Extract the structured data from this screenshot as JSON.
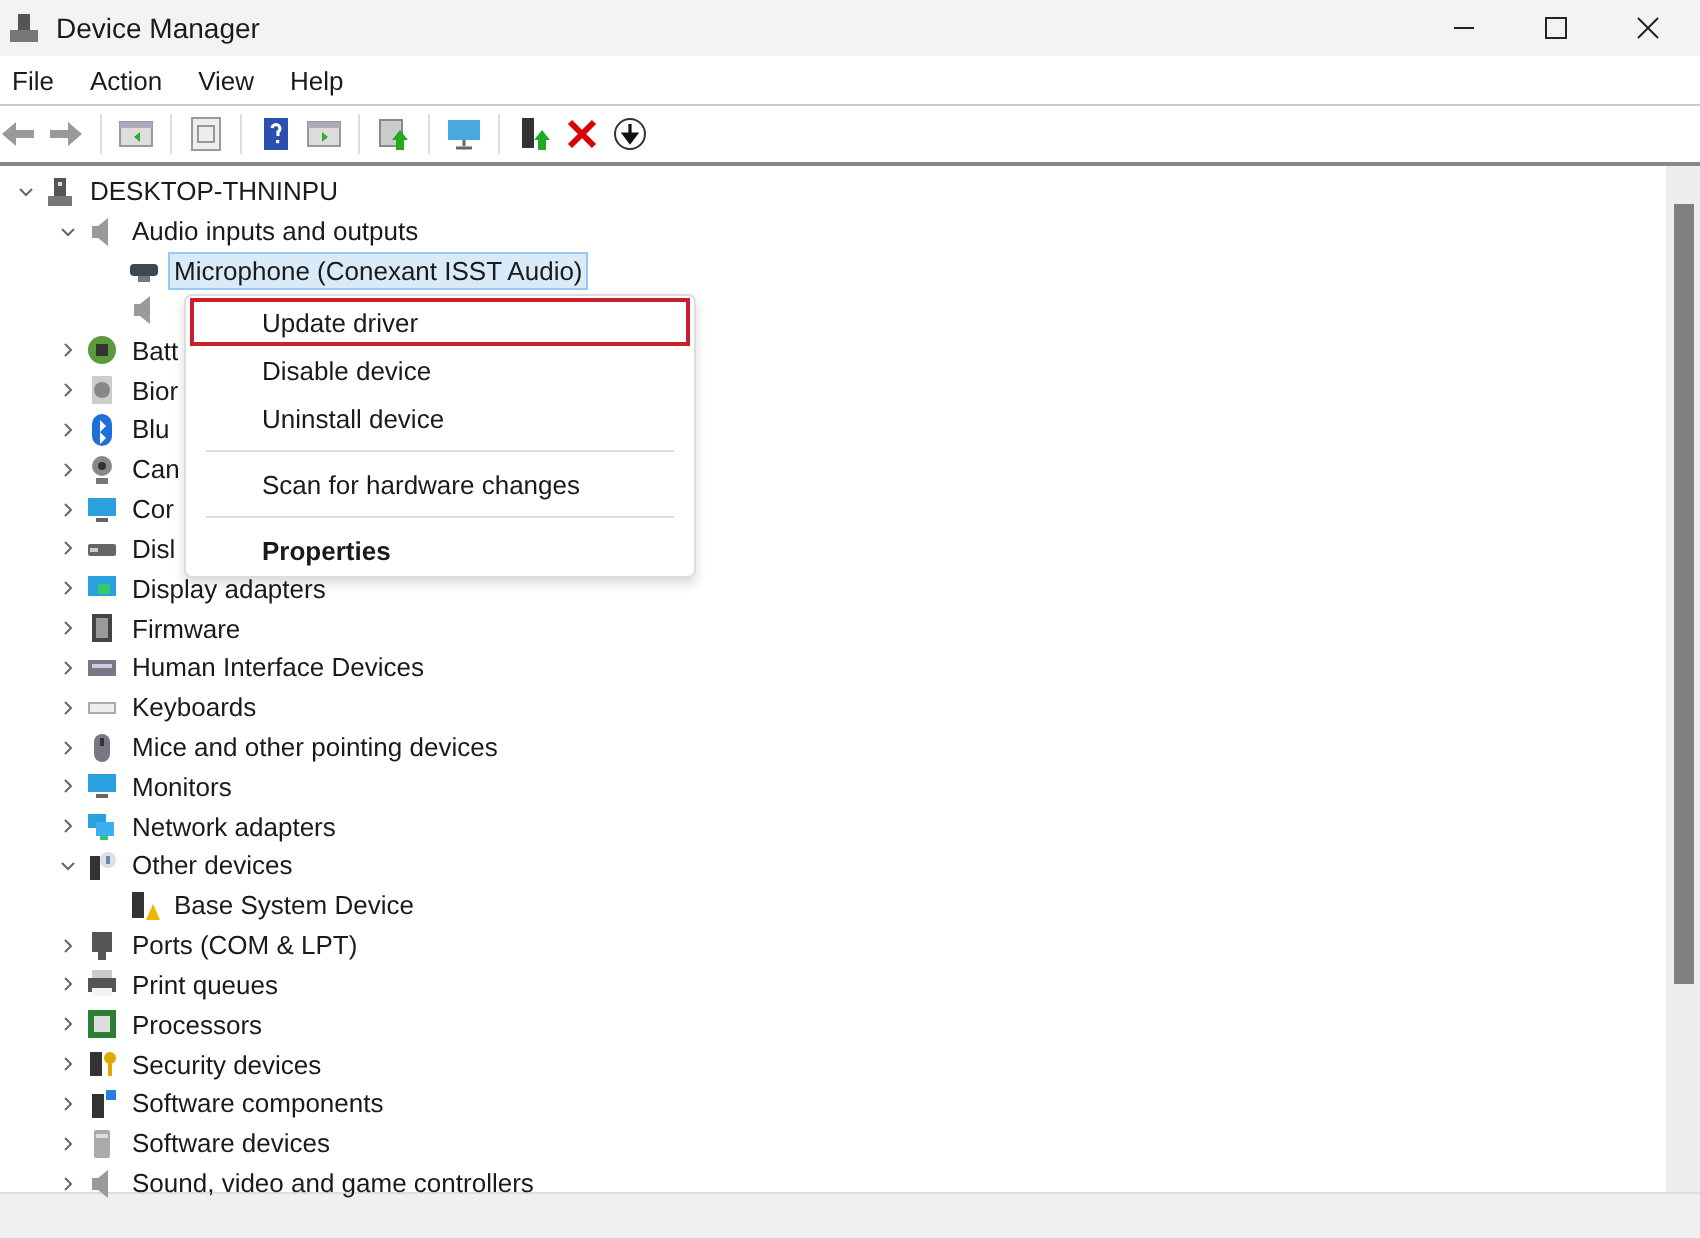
{
  "window": {
    "title": "Device Manager"
  },
  "menu_bar": [
    "File",
    "Action",
    "View",
    "Help"
  ],
  "tree": [
    {
      "label": "DESKTOP-THNINPU",
      "kind": "computer",
      "expanded": true,
      "selected": false,
      "children": [
        {
          "label": "Audio inputs and outputs",
          "kind": "speaker",
          "expanded": true,
          "selected": false,
          "children": [
            {
              "label": "Microphone (Conexant ISST Audio)",
              "kind": "microphone",
              "selected": true
            },
            {
              "kind": "speaker"
            }
          ]
        },
        {
          "label": "Batt",
          "kind": "battery",
          "expanded": false,
          "selected": false
        },
        {
          "label": "Bior",
          "kind": "fingerprint",
          "expanded": false,
          "selected": false
        },
        {
          "label": "Blu",
          "kind": "bluetooth",
          "expanded": false,
          "selected": false
        },
        {
          "label": "Can",
          "kind": "camera",
          "expanded": false,
          "selected": false
        },
        {
          "label": "Cor",
          "kind": "monitor",
          "expanded": false,
          "selected": false
        },
        {
          "label": "Disl",
          "kind": "disk",
          "expanded": false,
          "selected": false
        },
        {
          "label": "Display adapters",
          "kind": "display",
          "expanded": false,
          "selected": false
        },
        {
          "label": "Firmware",
          "kind": "firmware",
          "expanded": false,
          "selected": false
        },
        {
          "label": "Human Interface Devices",
          "kind": "hid",
          "expanded": false,
          "selected": false
        },
        {
          "label": "Keyboards",
          "kind": "keyboard",
          "expanded": false,
          "selected": false
        },
        {
          "label": "Mice and other pointing devices",
          "kind": "mouse",
          "expanded": false,
          "selected": false
        },
        {
          "label": "Monitors",
          "kind": "monitor",
          "expanded": false,
          "selected": false
        },
        {
          "label": "Network adapters",
          "kind": "network",
          "expanded": false,
          "selected": false
        },
        {
          "label": "Other devices",
          "kind": "other",
          "expanded": true,
          "selected": false,
          "children": [
            {
              "label": "Base System Device",
              "kind": "warning",
              "selected": false
            }
          ]
        },
        {
          "label": "Ports (COM & LPT)",
          "kind": "port",
          "expanded": false,
          "selected": false
        },
        {
          "label": "Print queues",
          "kind": "printer",
          "expanded": false,
          "selected": false
        },
        {
          "label": "Processors",
          "kind": "processor",
          "expanded": false,
          "selected": false
        },
        {
          "label": "Security devices",
          "kind": "security",
          "expanded": false,
          "selected": false
        },
        {
          "label": "Software components",
          "kind": "component",
          "expanded": false,
          "selected": false
        },
        {
          "label": "Software devices",
          "kind": "softdevice",
          "expanded": false,
          "selected": false
        },
        {
          "label": "Sound, video and game controllers",
          "kind": "speaker",
          "expanded": false,
          "selected": false
        }
      ]
    }
  ],
  "context_menu": [
    {
      "kind": "item",
      "label": "Update driver",
      "highlighted": true,
      "bold": false
    },
    {
      "kind": "item",
      "label": "Disable device",
      "highlighted": false,
      "bold": false
    },
    {
      "kind": "item",
      "label": "Uninstall device",
      "highlighted": false,
      "bold": false
    },
    {
      "kind": "separator"
    },
    {
      "kind": "item",
      "label": "Scan for hardware changes",
      "highlighted": false,
      "bold": false
    },
    {
      "kind": "separator"
    },
    {
      "kind": "item",
      "label": "Properties",
      "highlighted": false,
      "bold": true
    }
  ]
}
